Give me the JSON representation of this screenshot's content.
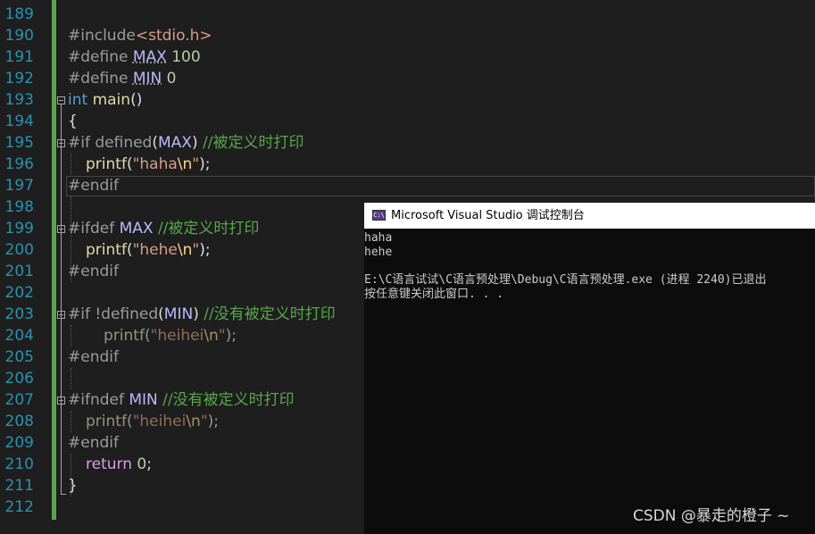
{
  "editor": {
    "line_numbers": [
      "189",
      "190",
      "191",
      "192",
      "193",
      "194",
      "195",
      "196",
      "197",
      "198",
      "199",
      "200",
      "201",
      "202",
      "203",
      "204",
      "205",
      "206",
      "207",
      "208",
      "209",
      "210",
      "211",
      "212"
    ],
    "code": {
      "include_directive": "#include",
      "include_lt": "<",
      "include_file": "stdio.h",
      "include_gt": ">",
      "define1_directive": "#define ",
      "define1_name": "MAX",
      "define1_value": " 100",
      "define2_directive": "#define ",
      "define2_name": "MIN",
      "define2_value": " 0",
      "main_type": "int",
      "main_name": " main",
      "main_parens": "()",
      "open_brace": "{",
      "if1_directive": "#if defined",
      "if1_open": "(",
      "if1_macro": "MAX",
      "if1_close": ") ",
      "if1_comment": "//被定义时打印",
      "printf1_fn": "printf",
      "printf1_open": "(",
      "printf1_str": "\"haha",
      "printf1_esc": "\\n",
      "printf1_strend": "\"",
      "printf1_close": ");",
      "endif1": "#endif",
      "ifdef_directive": "#ifdef ",
      "ifdef_macro": "MAX",
      "ifdef_comment": " //被定义时打印",
      "printf2_fn": "printf",
      "printf2_open": "(",
      "printf2_str": "\"hehe",
      "printf2_esc": "\\n",
      "printf2_strend": "\"",
      "printf2_close": ");",
      "endif2": "#endif",
      "if2_directive": "#if !defined",
      "if2_open": "(",
      "if2_macro": "MIN",
      "if2_close": ") ",
      "if2_comment": "//没有被定义时打印",
      "printf3_fn": "printf",
      "printf3_open": "(",
      "printf3_str": "\"heihei",
      "printf3_esc": "\\n",
      "printf3_strend": "\"",
      "printf3_close": ");",
      "endif3": "#endif",
      "ifndef_directive": "#ifndef ",
      "ifndef_macro": "MIN",
      "ifndef_comment": " //没有被定义时打印",
      "printf4_fn": "printf",
      "printf4_open": "(",
      "printf4_str": "\"heihei",
      "printf4_esc": "\\n",
      "printf4_strend": "\"",
      "printf4_close": ");",
      "endif4": "#endif",
      "return_kw": "return",
      "return_val": " 0",
      "return_semi": ";",
      "close_brace": "}"
    }
  },
  "console": {
    "icon_label": "C:\\",
    "title": "Microsoft Visual Studio 调试控制台",
    "lines": [
      "haha",
      "hehe",
      "",
      "E:\\C语言试试\\C语言预处理\\Debug\\C语言预处理.exe (进程 2240)已退出",
      "按任意键关闭此窗口. . ."
    ]
  },
  "watermark": "CSDN @暴走的橙子 ~",
  "colors": {
    "editor_bg": "#1e1e1e",
    "line_number": "#2b91af",
    "preprocessor": "#9b9b9b",
    "keyword": "#569cd6",
    "string": "#d69d85",
    "comment": "#57a64a",
    "macro": "#beb7ff",
    "console_bg": "#0c0c0c"
  }
}
